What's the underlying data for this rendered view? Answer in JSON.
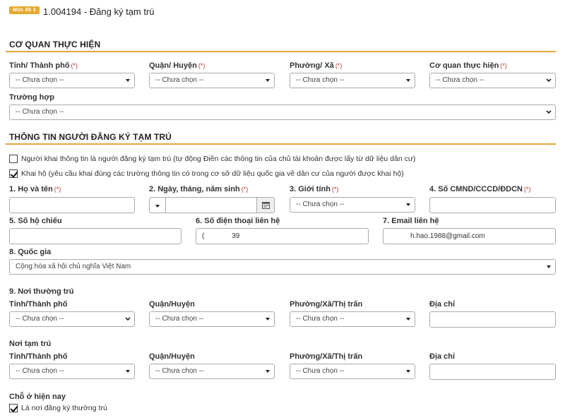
{
  "header": {
    "badge": "Mức độ 3",
    "title": "1.004194 - Đăng ký tạm trú"
  },
  "placeholder": "-- Chưa chọn --",
  "section1": {
    "title": "CƠ QUAN THỰC HIỆN",
    "province_label": "Tỉnh/ Thành phố",
    "district_label": "Quận/ Huyện",
    "ward_label": "Phường/ Xã",
    "agency_label": "Cơ quan thực hiện",
    "case_label": "Trường hợp",
    "required_mark": "(*)"
  },
  "section2": {
    "title": "THÔNG TIN NGƯỜI ĐĂNG KÝ TẠM TRÚ",
    "option_self": "Người khai thông tin là người đăng ký tạm trú (tự động Điền các thông tin của chủ tài khoản được lấy từ dữ liệu dân cư)",
    "option_proxy": "Khai hộ (yêu cầu khai đúng các trường thông tin có trong cơ sở dữ liệu quốc gia về dân cư của người được khai hộ)",
    "name_label": "1. Họ và tên",
    "dob_label": "2. Ngày, tháng, năm sinh",
    "gender_label": "3. Giới tính",
    "id_label": "4. Số CMND/CCCD/ĐDCN",
    "passport_label": "5. Số hộ chiếu",
    "phone_label": "6. Số điện thoại liên hệ",
    "phone_value": "(              39",
    "email_label": "7. Email liên hệ",
    "email_value": "h.hao.1988@gmail.com",
    "country_label": "8. Quốc gia",
    "country_value": "Cộng hòa xã hội chủ nghĩa Việt Nam",
    "permanent_heading": "9. Nơi thường trú",
    "temporary_heading": "Nơi tạm trú",
    "province_label": "Tỉnh/Thành phố",
    "district_label": "Quận/Huyện",
    "ward_label": "Phường/Xã/Thị trấn",
    "address_label": "Địa chỉ",
    "current_heading": "Chỗ ở hiện nay",
    "current_option": "Là nơi đăng ký thường trú"
  },
  "checkbox_state": {
    "self": false,
    "proxy": true,
    "same_as_permanent": true
  },
  "colors": {
    "accent": "#e2a73a",
    "badge": "#e6a82c",
    "required": "#c0392b"
  }
}
